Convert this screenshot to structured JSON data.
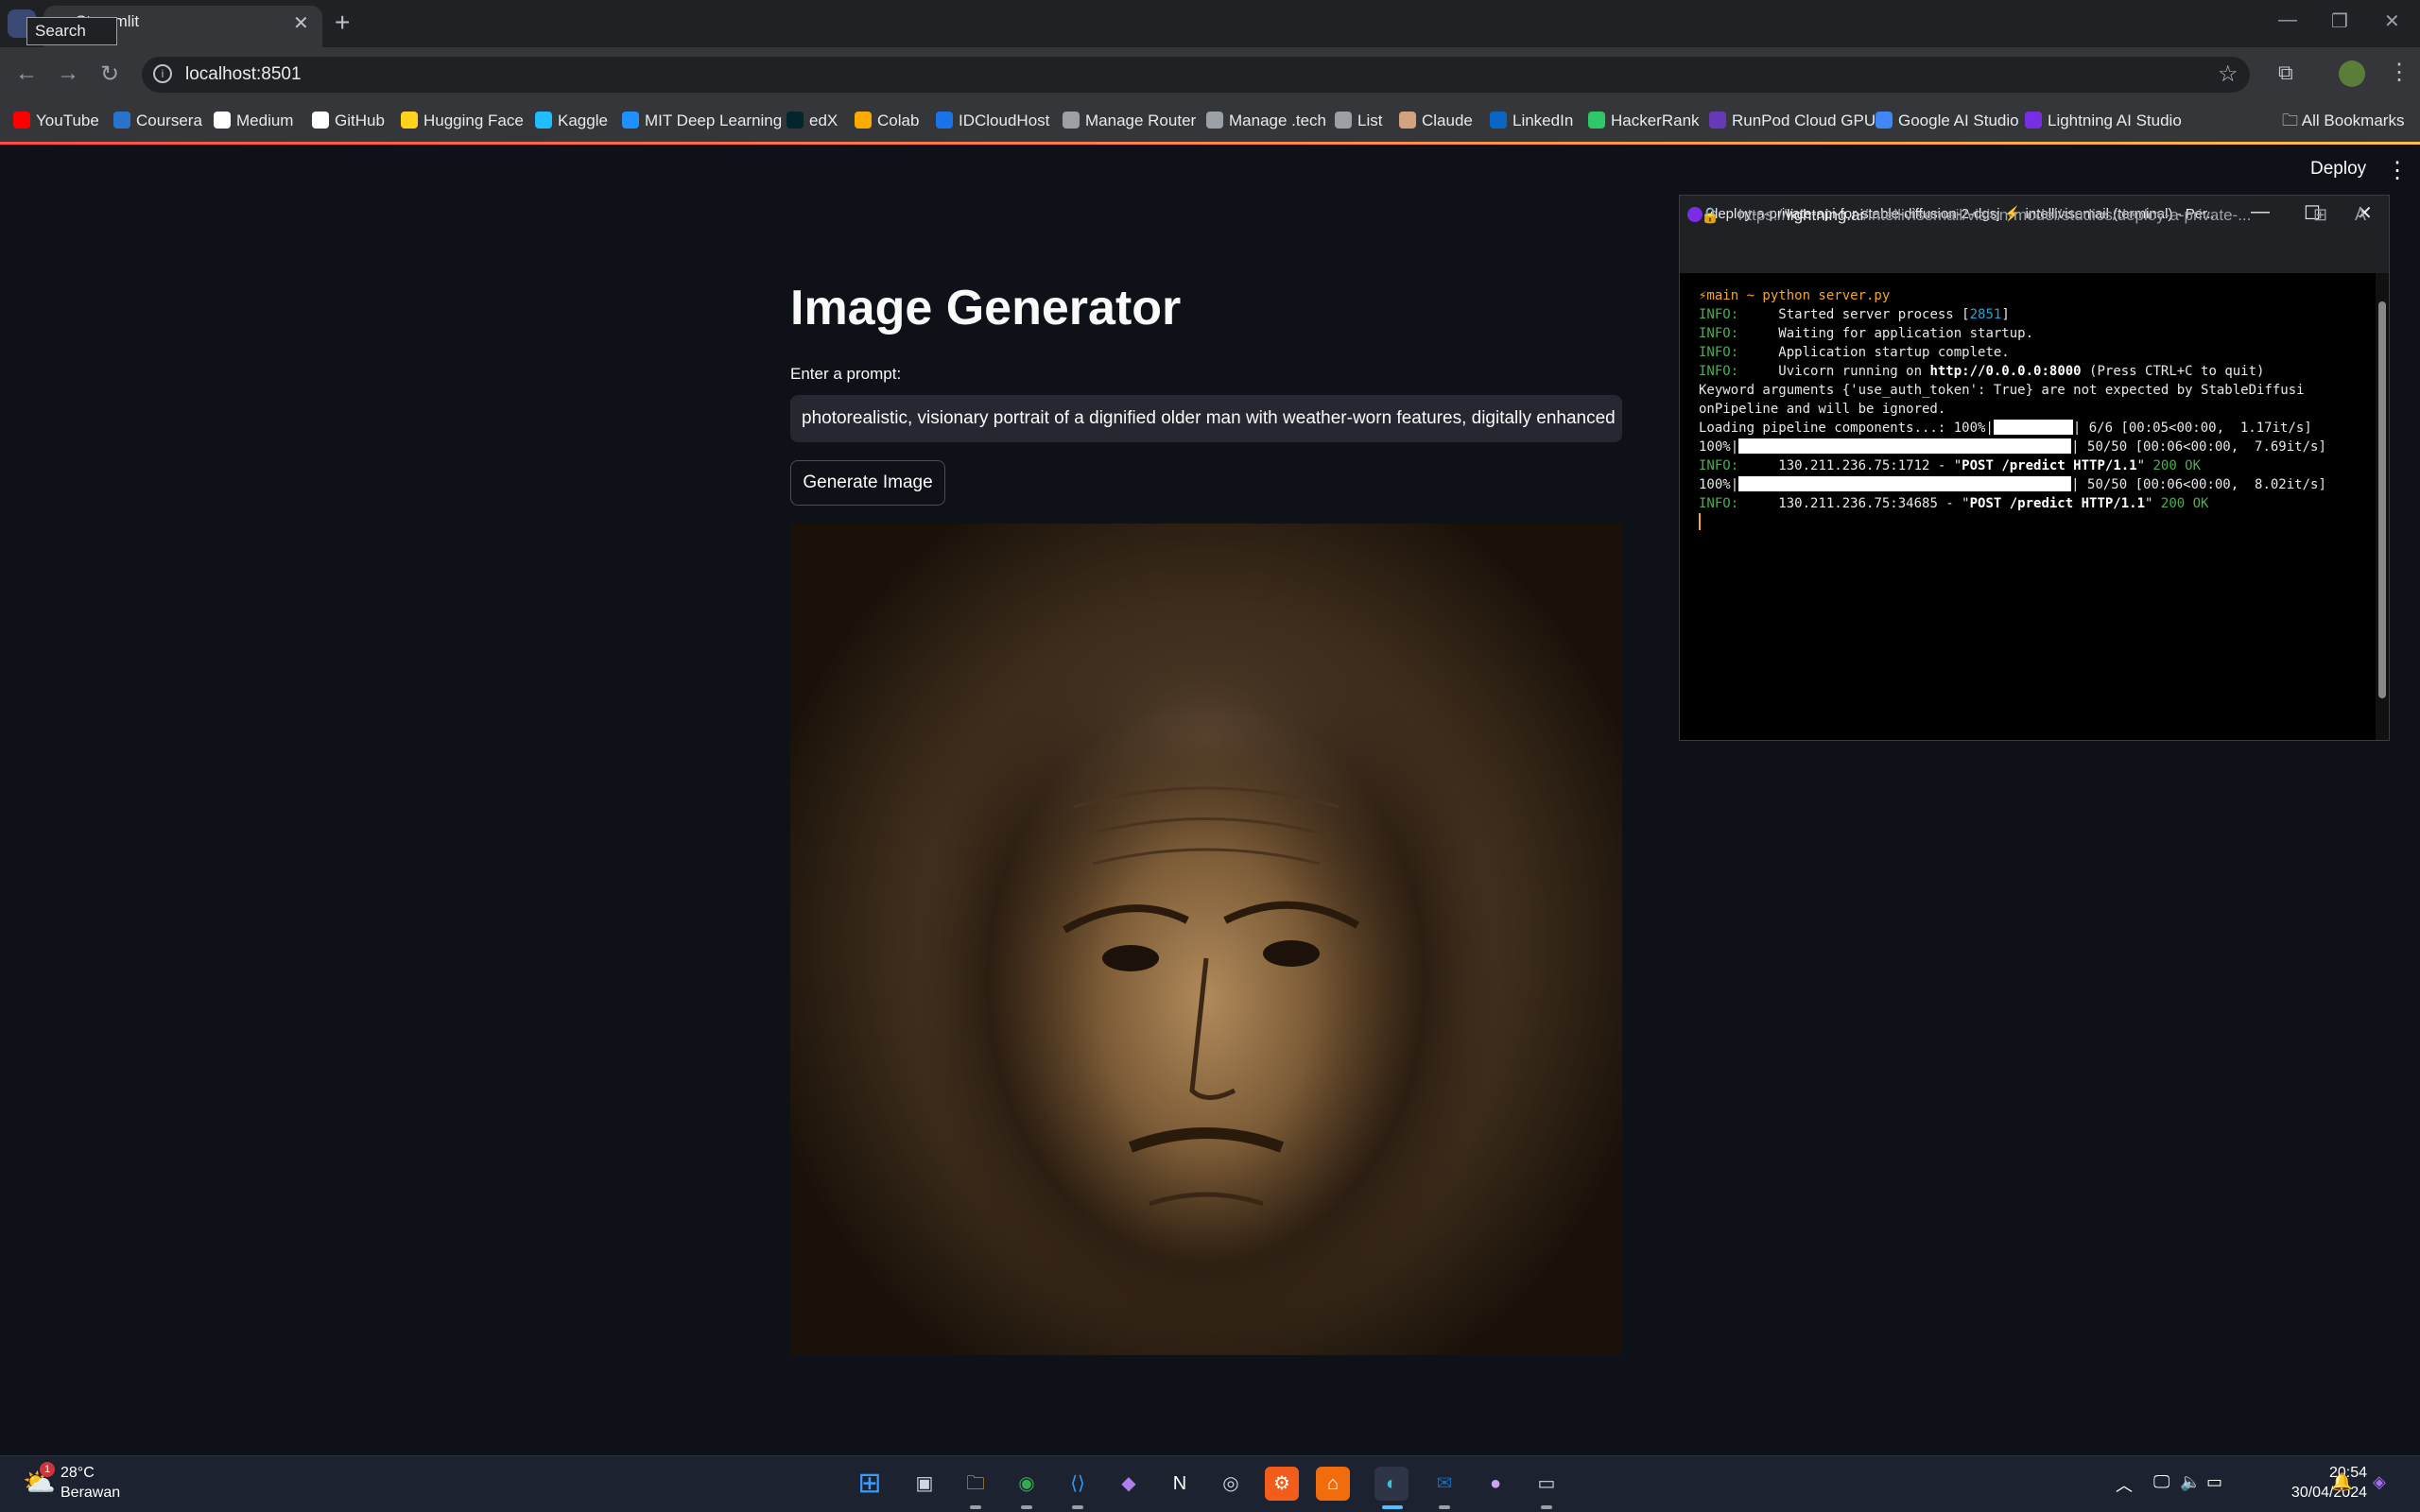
{
  "browser": {
    "tooltip": "Search tabs",
    "tab_title": "Streamlit",
    "tab_close": "✕",
    "new_tab": "+",
    "url": "localhost:8501",
    "bookmarks": [
      {
        "label": "YouTube",
        "icon": "youtube-icon",
        "color": "#ff0000"
      },
      {
        "label": "Coursera",
        "icon": "coursera-icon",
        "color": "#2a73cc"
      },
      {
        "label": "Medium",
        "icon": "medium-icon",
        "color": "#ffffff"
      },
      {
        "label": "GitHub",
        "icon": "github-icon",
        "color": "#ffffff"
      },
      {
        "label": "Hugging Face",
        "icon": "hugging-face-icon",
        "color": "#ffd21e"
      },
      {
        "label": "Kaggle",
        "icon": "kaggle-icon",
        "color": "#20beff"
      },
      {
        "label": "MIT Deep Learning",
        "icon": "mit-icon",
        "color": "#1e90ff"
      },
      {
        "label": "edX",
        "icon": "edx-icon",
        "color": "#02262b"
      },
      {
        "label": "Colab",
        "icon": "colab-icon",
        "color": "#f9ab00"
      },
      {
        "label": "IDCloudHost",
        "icon": "idcloudhost-icon",
        "color": "#1a73e8"
      },
      {
        "label": "Manage Router",
        "icon": "globe-icon",
        "color": "#9aa0a6"
      },
      {
        "label": "Manage .tech",
        "icon": "globe-icon",
        "color": "#9aa0a6"
      },
      {
        "label": "List",
        "icon": "globe-icon",
        "color": "#9aa0a6"
      },
      {
        "label": "Claude",
        "icon": "claude-icon",
        "color": "#d4a27f"
      },
      {
        "label": "LinkedIn",
        "icon": "linkedin-icon",
        "color": "#0a66c2"
      },
      {
        "label": "HackerRank",
        "icon": "hackerrank-icon",
        "color": "#2ec866"
      },
      {
        "label": "RunPod Cloud GPU",
        "icon": "runpod-icon",
        "color": "#673ab7"
      },
      {
        "label": "Google AI Studio",
        "icon": "google-ai-studio-icon",
        "color": "#4285f4"
      },
      {
        "label": "Lightning AI Studio",
        "icon": "lightning-icon",
        "color": "#792ee5"
      }
    ],
    "all_bookmarks": "All Bookmarks"
  },
  "app": {
    "deploy_label": "Deploy",
    "menu": "⋮",
    "title": "Image Generator",
    "prompt_label": "Enter a prompt:",
    "prompt_value": "photorealistic, visionary portrait of a dignified older man with weather-worn features, digitally enhanced",
    "generate_button": "Generate Image",
    "image_alt": "portrait-image"
  },
  "terminal_window": {
    "title": "deploy-a-private-api-for-stable-diffusion-2-dgsj  ⚡ intellivisemail (terminal) - Per...",
    "url_prefix": "https://",
    "url_host": "lightning.ai",
    "url_path": "/intellivisemail/vision-model/studios/deploy-a-private-...",
    "lines": {
      "prompt": "⚡main ~ python server.py",
      "l1_label": "INFO:",
      "l1_text": "     Started server process [",
      "l1_pid": "2851",
      "l1_end": "]",
      "l2": "     Waiting for application startup.",
      "l3": "     Application startup complete.",
      "l4_pre": "     Uvicorn running on ",
      "l4_url": "http://0.0.0.0:8000",
      "l4_post": " (Press CTRL+C to quit)",
      "l5": "Keyword arguments {'use_auth_token': True} are not expected by StableDiffusi",
      "l6": "onPipeline and will be ignored.",
      "l7_pre": "Loading pipeline components...: 100%|",
      "l7_post": "| 6/6 [00:05<00:00,  1.17it/s]",
      "l8_pre": "100%|",
      "l8_post": "| 50/50 [00:06<00:00,  7.69it/s]",
      "l9_pre": "     130.211.236.75:1712 - \"",
      "l9_req": "POST /predict HTTP/1.1",
      "l9_mid": "\" ",
      "l9_status": "200 OK",
      "l10_pre": "100%|",
      "l10_post": "| 50/50 [00:06<00:00,  8.02it/s]",
      "l11_pre": "     130.211.236.75:34685 - \"",
      "l11_req": "POST /predict HTTP/1.1",
      "l11_mid": "\" ",
      "l11_status": "200 OK"
    }
  },
  "taskbar": {
    "weather_temp": "28°C",
    "weather_desc": "Berawan",
    "weather_badge": "1",
    "time": "20:54",
    "date": "30/04/2024"
  }
}
